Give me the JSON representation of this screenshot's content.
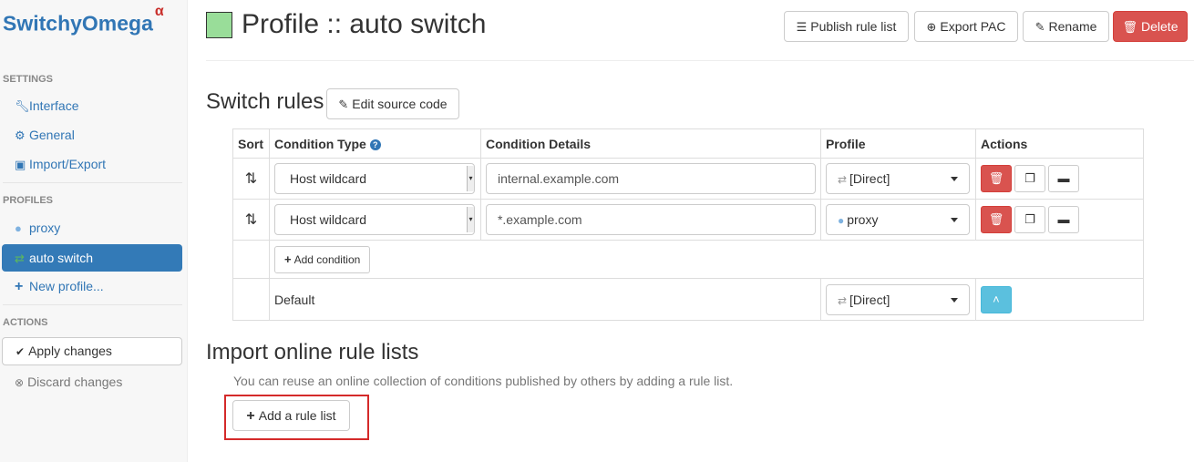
{
  "sidebar": {
    "brand": "SwitchyOmega",
    "brand_suffix": "α",
    "settings_header": "SETTINGS",
    "settings_items": [
      {
        "label": "Interface",
        "icon": "wrench-icon"
      },
      {
        "label": "General",
        "icon": "gear-icon"
      },
      {
        "label": "Import/Export",
        "icon": "floppy-icon"
      }
    ],
    "profiles_header": "PROFILES",
    "profile_items": [
      {
        "label": "proxy",
        "icon": "globe-icon"
      },
      {
        "label": "auto switch",
        "icon": "retweet-icon",
        "active": true
      },
      {
        "label": "New profile...",
        "icon": "plus-icon"
      }
    ],
    "actions_header": "ACTIONS",
    "apply_label": "Apply changes",
    "discard_label": "Discard changes"
  },
  "header": {
    "title": "Profile :: auto switch",
    "swatch_color": "#99dd99",
    "publish_label": "Publish rule list",
    "export_label": "Export PAC",
    "rename_label": "Rename",
    "delete_label": "Delete"
  },
  "switch_rules": {
    "heading": "Switch rules",
    "edit_source_label": "Edit source code",
    "columns": {
      "sort": "Sort",
      "condition_type": "Condition Type",
      "condition_details": "Condition Details",
      "profile": "Profile",
      "actions": "Actions"
    },
    "rules": [
      {
        "condition_type": "Host wildcard",
        "condition_details": "internal.example.com",
        "profile": "[Direct]",
        "profile_icon": "exchange-icon"
      },
      {
        "condition_type": "Host wildcard",
        "condition_details": "*.example.com",
        "profile": "proxy",
        "profile_icon": "globe-icon"
      }
    ],
    "add_condition_label": "Add condition",
    "default_label": "Default",
    "default_profile": "[Direct]"
  },
  "import": {
    "heading": "Import online rule lists",
    "hint": "You can reuse an online collection of conditions published by others by adding a rule list.",
    "add_rule_list_label": "Add a rule list"
  },
  "colors": {
    "accent": "#337ab7",
    "danger": "#d9534f",
    "info": "#5bc0de",
    "highlight_box": "#d42a2a"
  }
}
